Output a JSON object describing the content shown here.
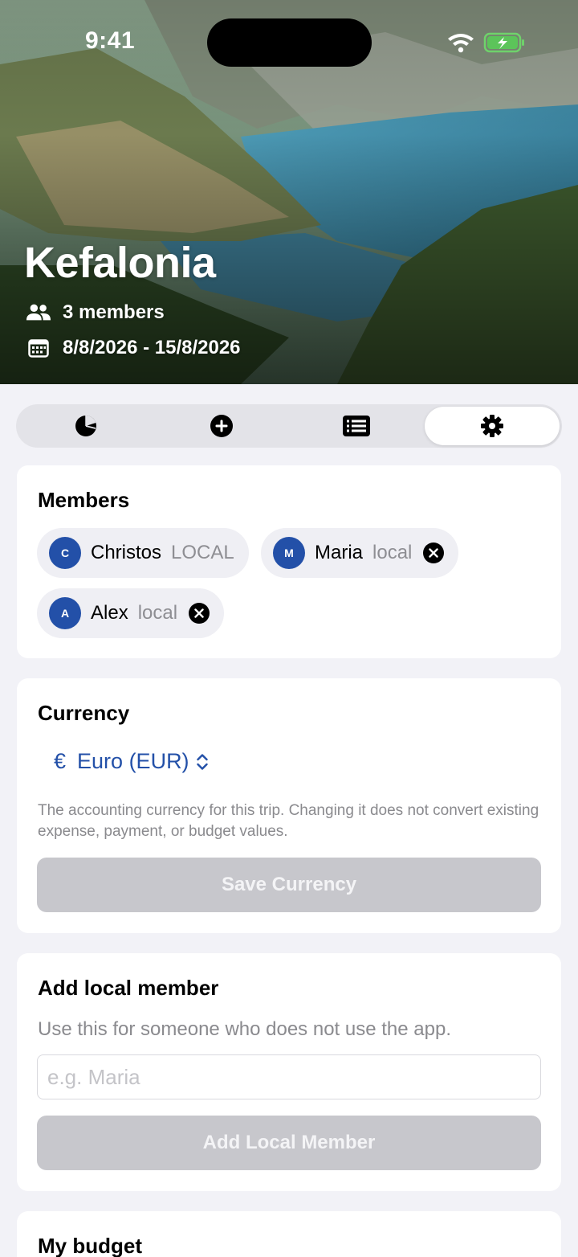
{
  "status_bar": {
    "time": "9:41"
  },
  "trip": {
    "title": "Kefalonia",
    "members_text": "3 members",
    "dates_text": "8/8/2026 - 15/8/2026"
  },
  "tabs": [
    {
      "icon": "pie-chart-icon",
      "selected": false
    },
    {
      "icon": "plus-circle-icon",
      "selected": false
    },
    {
      "icon": "list-icon",
      "selected": false
    },
    {
      "icon": "gear-icon",
      "selected": true
    }
  ],
  "members_card": {
    "title": "Members",
    "members": [
      {
        "initial": "C",
        "name": "Christos",
        "tag": "LOCAL",
        "removable": false
      },
      {
        "initial": "M",
        "name": "Maria",
        "tag": "local",
        "removable": true
      },
      {
        "initial": "A",
        "name": "Alex",
        "tag": "local",
        "removable": true
      }
    ]
  },
  "currency_card": {
    "title": "Currency",
    "symbol": "€",
    "selected_currency": "Euro (EUR)",
    "help_text": "The accounting currency for this trip. Changing it does not convert existing expense, payment, or budget values.",
    "save_label": "Save Currency"
  },
  "add_member_card": {
    "title": "Add local member",
    "subtitle": "Use this for someone who does not use the app.",
    "input_placeholder": "e.g. Maria",
    "input_value": "",
    "button_label": "Add Local Member"
  },
  "budget_card": {
    "title": "My budget"
  },
  "colors": {
    "accent": "#2350a8",
    "page_background": "#f2f2f7",
    "disabled_button": "#c7c7cc"
  }
}
